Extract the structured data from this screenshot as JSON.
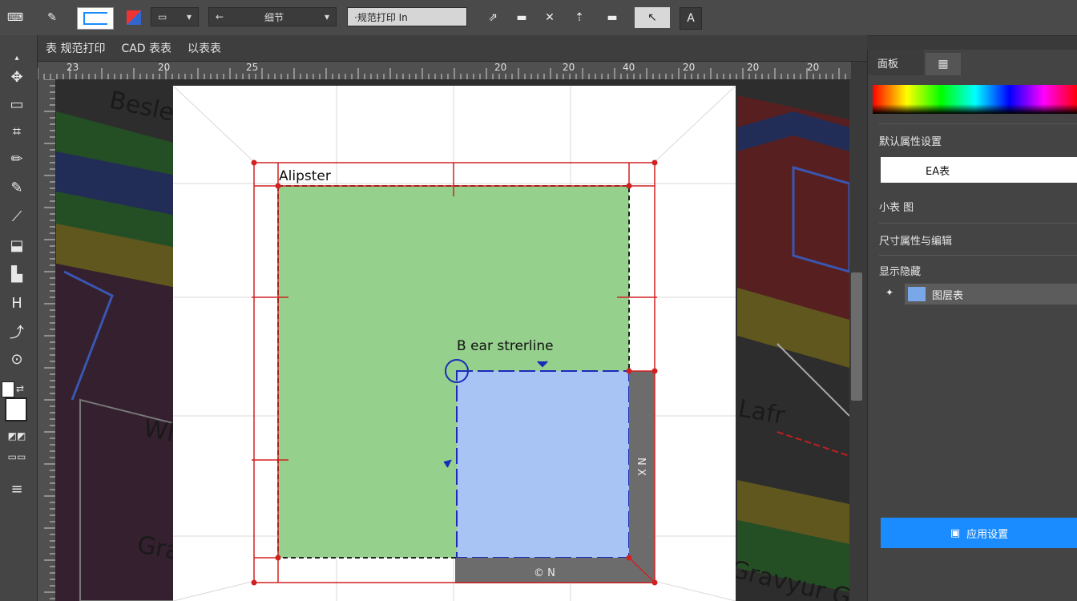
{
  "option_bar": {
    "field_1": "←",
    "field_2": "细节",
    "field_3": "·规范打印 In",
    "icon_names": [
      "pen-tool-icon",
      "rect-select-icon",
      "color-swatch-icon",
      "dropdown-icon",
      "dropdown-icon",
      "arrow-icon",
      "line-icon",
      "close-x-icon",
      "up-arrow-icon",
      "bar-icon",
      "cursor-icon",
      "font-icon"
    ]
  },
  "doc_tabs": [
    "表 规范打印",
    "CAD 表表",
    "以表表"
  ],
  "hruler_labels": [
    "23",
    "20",
    "25",
    "20",
    "20",
    "40",
    "20",
    "20",
    "20",
    "20"
  ],
  "vruler_labels": [
    "1",
    "1",
    "1",
    "1",
    "1",
    "1",
    "1",
    "1",
    "1",
    "1",
    "1",
    "1",
    "1",
    "1"
  ],
  "canvas": {
    "label_outer": "Alipster",
    "label_inner": "B ear strerline",
    "bottom_label": "© N",
    "side_label": "N X",
    "bg_words": [
      "Beslei",
      "Wh",
      "Gra",
      "Lafr",
      "Gravyur Gr"
    ]
  },
  "right_panel": {
    "tab_1": "面板",
    "tab_2": "",
    "label_1": "默认属性设置",
    "input_value": "EA表",
    "label_2": "小表  图",
    "label_3": "尺寸属性与编辑",
    "label_4": "显示隐藏",
    "layer_item": "图层表",
    "button_label": "应用设置"
  },
  "colors": {
    "green_area": "#95d08c",
    "blue_area": "#a8c4f5",
    "red_guides": "#d22020",
    "accent_button": "#1a8cff"
  }
}
